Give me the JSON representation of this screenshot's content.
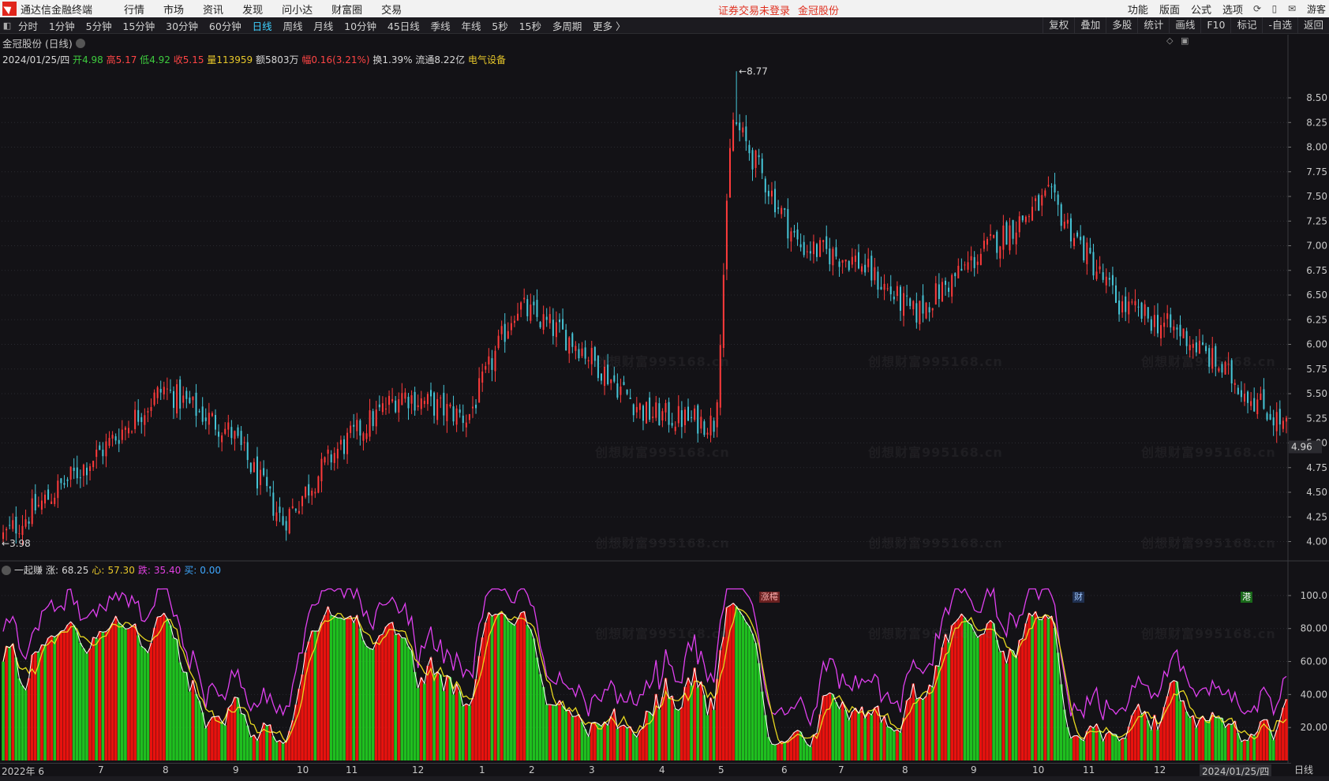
{
  "app": {
    "title": "通达信金融终端"
  },
  "menu": [
    "行情",
    "市场",
    "资讯",
    "发现",
    "问小达",
    "财富圈",
    "交易"
  ],
  "notice": {
    "login": "证券交易未登录",
    "stock": "金冠股份"
  },
  "right_menu": {
    "items": [
      "功能",
      "版面",
      "公式",
      "选项"
    ],
    "guest": "游客"
  },
  "periods": {
    "items": [
      "分时",
      "1分钟",
      "5分钟",
      "15分钟",
      "30分钟",
      "60分钟",
      "日线",
      "周线",
      "月线",
      "10分钟",
      "45日线",
      "季线",
      "年线",
      "5秒",
      "15秒",
      "多周期",
      "更多 〉"
    ],
    "active": "日线"
  },
  "tools": [
    "复权",
    "叠加",
    "多股",
    "统计",
    "画线",
    "F10",
    "标记",
    "-自选",
    "返回"
  ],
  "stock": {
    "title": "金冠股份 (日线)",
    "date": "2024/01/25/四",
    "open_label": "开",
    "open": "4.98",
    "high_label": "高",
    "high": "5.17",
    "low_label": "低",
    "low": "4.92",
    "close_label": "收",
    "close": "5.15",
    "vol_label": "量",
    "vol": "113959",
    "amt_label": "额",
    "amt": "5803万",
    "chg_label": "幅",
    "chg": "0.16(3.21%)",
    "turn_label": "换",
    "turn": "1.39%",
    "float_label": "流通",
    "float": "8.22亿",
    "sector": "电气设备"
  },
  "price_axis": {
    "ticks": [
      "8.50",
      "8.25",
      "8.00",
      "7.75",
      "7.50",
      "7.25",
      "7.00",
      "6.75",
      "6.50",
      "6.25",
      "6.00",
      "5.75",
      "5.50",
      "5.25",
      "5.00",
      "4.75",
      "4.50",
      "4.25",
      "4.00"
    ],
    "current": "4.96",
    "max_label": "8.77",
    "min_label": "3.98"
  },
  "events": {
    "limit": "涨樗",
    "finance": "财",
    "hk": "港"
  },
  "indicator": {
    "name": "一起赚",
    "up_label": "涨:",
    "up": "68.25",
    "heart_label": "心:",
    "heart": "57.30",
    "down_label": "跌:",
    "down": "35.40",
    "buy_label": "买:",
    "buy": "0.00",
    "ticks": [
      "100.0",
      "80.00",
      "60.00",
      "40.00",
      "20.00"
    ]
  },
  "date_axis": {
    "labels": [
      "2022年 6",
      "7",
      "8",
      "9",
      "10",
      "11",
      "12",
      "1",
      "2",
      "3",
      "4",
      "5",
      "6",
      "7",
      "8",
      "9",
      "10",
      "11",
      "12"
    ],
    "current": "2024/01/25/四",
    "period": "日线"
  },
  "watermark": "创想财富995168.cn",
  "colors": {
    "up": "#ff3b3b",
    "down": "#46c6d8",
    "green_bar": "#1fbf1f",
    "red_bar": "#e8120e",
    "heart_line": "#e8d820",
    "up_line": "#e040f0",
    "white_line": "#ffffff"
  },
  "chart_data": {
    "type": "candlestick",
    "title": "金冠股份 (日线)",
    "ylim": [
      3.9,
      8.9
    ],
    "x_range": [
      "2022-06",
      "2024-01-25"
    ],
    "highest": 8.77,
    "lowest": 3.98,
    "waypoints": [
      {
        "x": "2022-06",
        "close": 4.05
      },
      {
        "x": "2022-07",
        "close": 4.9
      },
      {
        "x": "2022-08",
        "close": 5.55
      },
      {
        "x": "2022-09",
        "close": 5.1
      },
      {
        "x": "2022-10",
        "close": 4.2
      },
      {
        "x": "2022-11",
        "close": 4.9
      },
      {
        "x": "2022-12",
        "close": 5.5
      },
      {
        "x": "2023-01",
        "close": 5.25
      },
      {
        "x": "2023-02",
        "close": 6.4
      },
      {
        "x": "2023-03",
        "close": 6.0
      },
      {
        "x": "2023-04",
        "close": 5.3
      },
      {
        "x": "2023-05",
        "close": 5.2
      },
      {
        "x": "2023-05-31",
        "close": 8.3
      },
      {
        "x": "2023-06",
        "close": 7.0
      },
      {
        "x": "2023-07",
        "close": 6.85
      },
      {
        "x": "2023-08",
        "close": 6.3
      },
      {
        "x": "2023-09",
        "close": 6.9
      },
      {
        "x": "2023-10",
        "close": 7.5
      },
      {
        "x": "2023-11",
        "close": 6.4
      },
      {
        "x": "2023-12",
        "close": 6.1
      },
      {
        "x": "2024-01-25",
        "close": 5.15
      }
    ],
    "indicator": {
      "name": "一起赚",
      "ylim": [
        0,
        110
      ],
      "series": [
        {
          "name": "涨",
          "last": 68.25
        },
        {
          "name": "心",
          "last": 57.3
        },
        {
          "name": "跌",
          "last": 35.4
        },
        {
          "name": "买",
          "last": 0.0
        }
      ]
    }
  }
}
